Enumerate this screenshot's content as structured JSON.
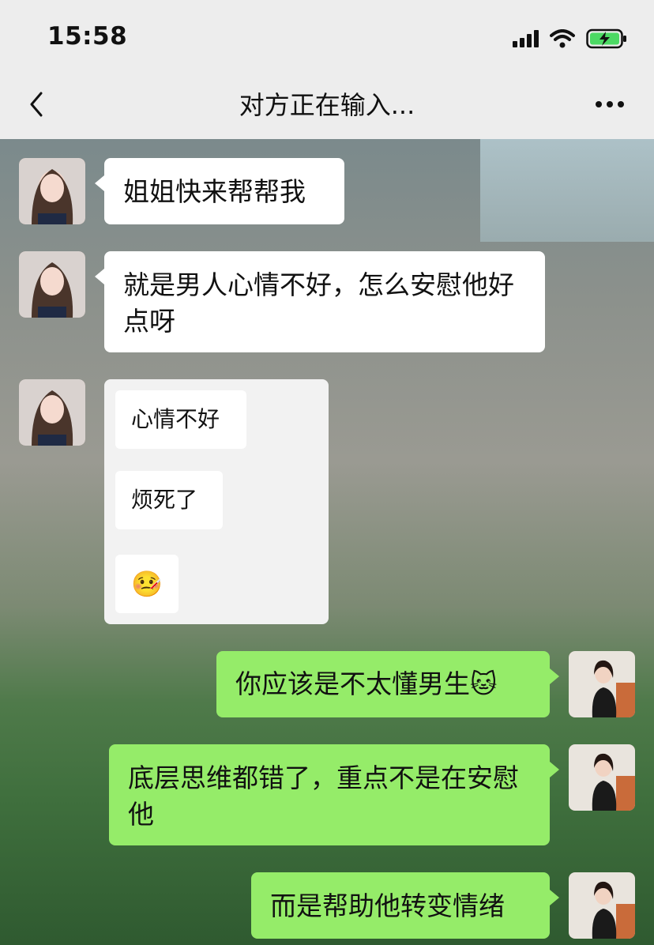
{
  "status_bar": {
    "time": "15:58"
  },
  "nav": {
    "title": "对方正在输入..."
  },
  "messages": [
    {
      "side": "left",
      "text": "姐姐快来帮帮我"
    },
    {
      "side": "left",
      "text": "就是男人心情不好，怎么安慰他好点呀"
    },
    {
      "side": "left",
      "type": "quote",
      "items": [
        "心情不好",
        "烦死了",
        "🤒"
      ]
    },
    {
      "side": "right",
      "text": "你应该是不太懂男生🐱"
    },
    {
      "side": "right",
      "text": "底层思维都错了，重点不是在安慰他"
    },
    {
      "side": "right",
      "text": "而是帮助他转变情绪"
    }
  ],
  "colors": {
    "bubble_green": "#95ec69",
    "bubble_white": "#ffffff",
    "nav_bg": "#ededed"
  }
}
